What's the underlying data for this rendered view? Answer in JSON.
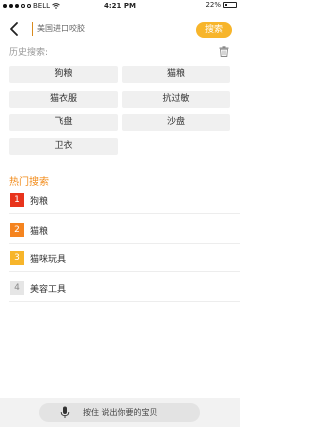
{
  "status_bar": {
    "carrier": "BELL",
    "time": "4:21 PM",
    "battery_percent": "22%",
    "battery_level": 0.22
  },
  "search": {
    "query": "美国进口咬胶",
    "button_label": "搜索"
  },
  "history": {
    "title": "历史搜索:",
    "items": [
      "狗粮",
      "猫粮",
      "猫衣服",
      "抗过敏",
      "飞盘",
      "沙盘",
      "卫衣"
    ]
  },
  "hot": {
    "title": "热门搜索",
    "items": [
      {
        "rank": "1",
        "label": "狗粮",
        "color": "#e8341c"
      },
      {
        "rank": "2",
        "label": "猫粮",
        "color": "#f5841f"
      },
      {
        "rank": "3",
        "label": "猫咪玩具",
        "color": "#f7b52b"
      },
      {
        "rank": "4",
        "label": "美容工具",
        "color": "#e6e6e6"
      }
    ]
  },
  "voice": {
    "label": "按住   说出你要的宝贝"
  }
}
